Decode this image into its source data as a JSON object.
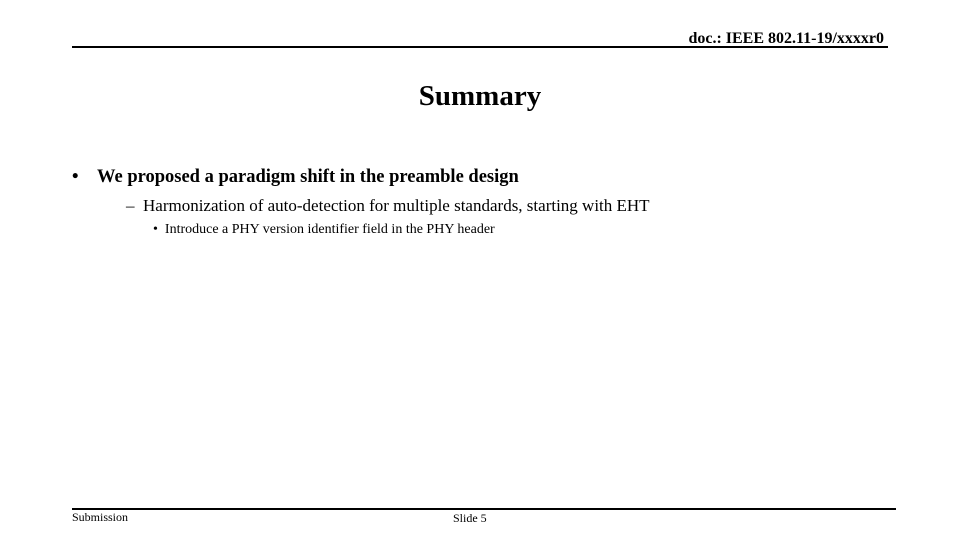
{
  "header": {
    "doc_id": "doc.: IEEE 802.11-19/xxxxr0"
  },
  "slide": {
    "title": "Summary",
    "bullets": [
      {
        "level": 1,
        "marker": "•",
        "text": "We proposed a paradigm shift in the preamble design"
      },
      {
        "level": 2,
        "marker": "–",
        "text": "Harmonization of auto-detection for multiple standards, starting with EHT"
      },
      {
        "level": 3,
        "marker": "•",
        "text": "Introduce a PHY version identifier field in the PHY header"
      }
    ]
  },
  "footer": {
    "left": "Submission",
    "center": "Slide 5"
  }
}
